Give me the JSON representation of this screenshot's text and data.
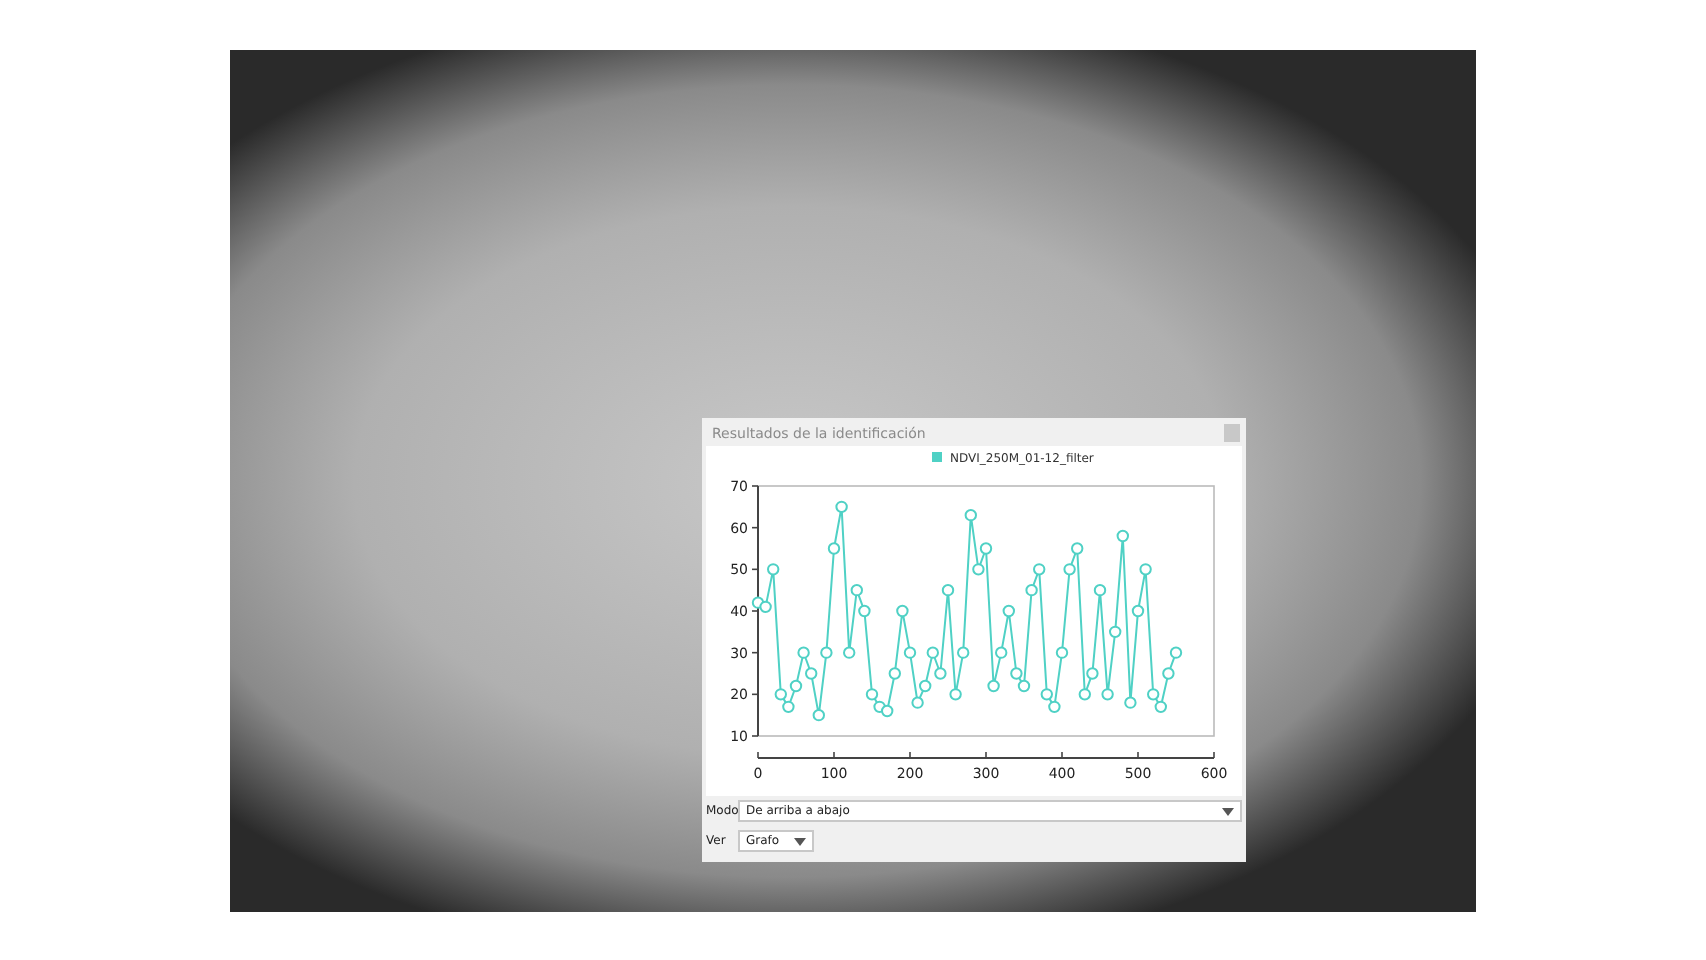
{
  "map": {
    "kind": "satellite-image"
  },
  "panel": {
    "title": "Resultados de la identificación",
    "chart_data": {
      "type": "line",
      "xlim": [
        0,
        600
      ],
      "ylim": [
        10,
        70
      ],
      "xticks": [
        0,
        100,
        200,
        300,
        400,
        500,
        600
      ],
      "yticks": [
        10,
        20,
        30,
        40,
        50,
        60,
        70
      ],
      "x": [
        0,
        10,
        20,
        30,
        40,
        50,
        60,
        70,
        80,
        90,
        100,
        110,
        120,
        130,
        140,
        150,
        160,
        170,
        180,
        190,
        200,
        210,
        220,
        230,
        240,
        250,
        260,
        270,
        280,
        290,
        300,
        310,
        320,
        330,
        340,
        350,
        360,
        370,
        380,
        390,
        400,
        410,
        420,
        430,
        440,
        450,
        460,
        470,
        480,
        490,
        500,
        510,
        520,
        530,
        540,
        550
      ],
      "series": [
        {
          "name": "NDVI_250M_01-12_filter",
          "color": "#4fd1c5",
          "marker": "circle",
          "values": [
            42,
            41,
            50,
            20,
            17,
            22,
            30,
            25,
            15,
            30,
            55,
            65,
            30,
            45,
            40,
            20,
            17,
            16,
            25,
            40,
            30,
            18,
            22,
            30,
            25,
            45,
            20,
            30,
            63,
            50,
            55,
            22,
            30,
            40,
            25,
            22,
            45,
            50,
            20,
            17,
            30,
            50,
            55,
            20,
            25,
            45,
            20,
            35,
            58,
            18,
            40,
            50,
            20,
            17,
            25,
            30
          ]
        }
      ]
    },
    "mode": {
      "label": "Modo",
      "value": "De arriba a abajo"
    },
    "view": {
      "label": "Ver",
      "value": "Grafo"
    }
  }
}
